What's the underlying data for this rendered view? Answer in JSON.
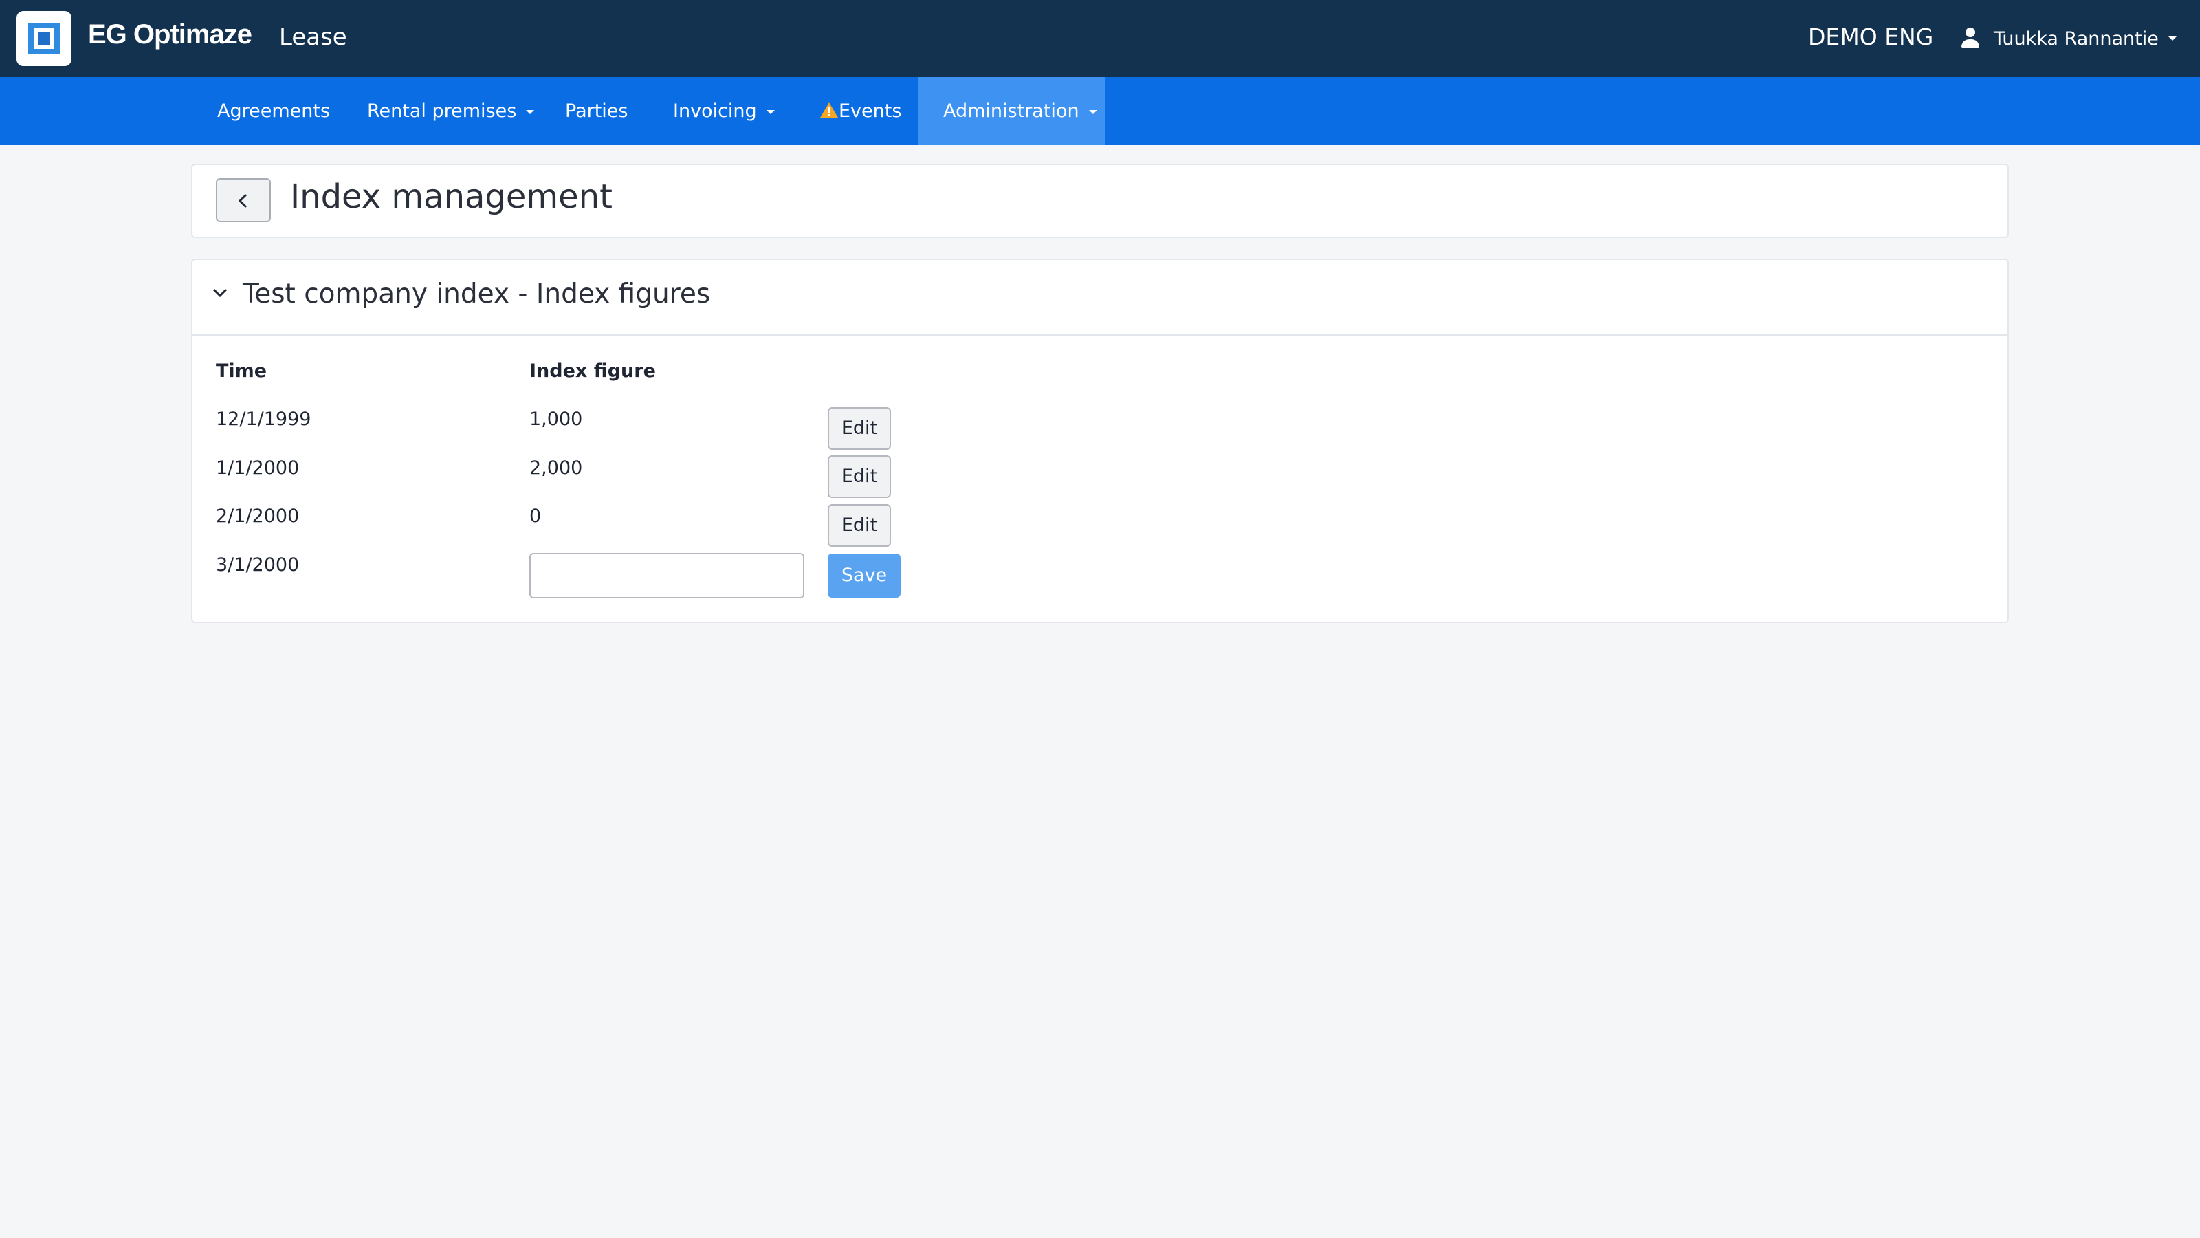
{
  "app": {
    "brand": "EG Optimaze",
    "module": "Lease",
    "environment": "DEMO ENG",
    "user_name": "Tuukka Rannantie"
  },
  "nav": {
    "items": [
      {
        "label": "Agreements",
        "dropdown": false,
        "active": false
      },
      {
        "label": "Rental premises",
        "dropdown": true,
        "active": false
      },
      {
        "label": "Parties",
        "dropdown": false,
        "active": false
      },
      {
        "label": "Invoicing",
        "dropdown": true,
        "active": false
      },
      {
        "label": "Events",
        "dropdown": false,
        "active": false,
        "icon": "warning-icon"
      },
      {
        "label": "Administration",
        "dropdown": true,
        "active": true
      }
    ]
  },
  "page": {
    "title": "Index management"
  },
  "section": {
    "title": "Test company index - Index figures",
    "columns": {
      "time": "Time",
      "figure": "Index figure"
    },
    "rows": [
      {
        "time": "12/1/1999",
        "figure": "1,000",
        "action": "Edit"
      },
      {
        "time": "1/1/2000",
        "figure": "2,000",
        "action": "Edit"
      },
      {
        "time": "2/1/2000",
        "figure": "0",
        "action": "Edit"
      }
    ],
    "new_row": {
      "time": "3/1/2000",
      "value": "",
      "action": "Save"
    }
  },
  "colors": {
    "topbar": "#13324f",
    "navbar": "#0a6de3",
    "nav_active": "#3d92f2",
    "save_button": "#5aa3f0",
    "warning": "#f5a623"
  }
}
